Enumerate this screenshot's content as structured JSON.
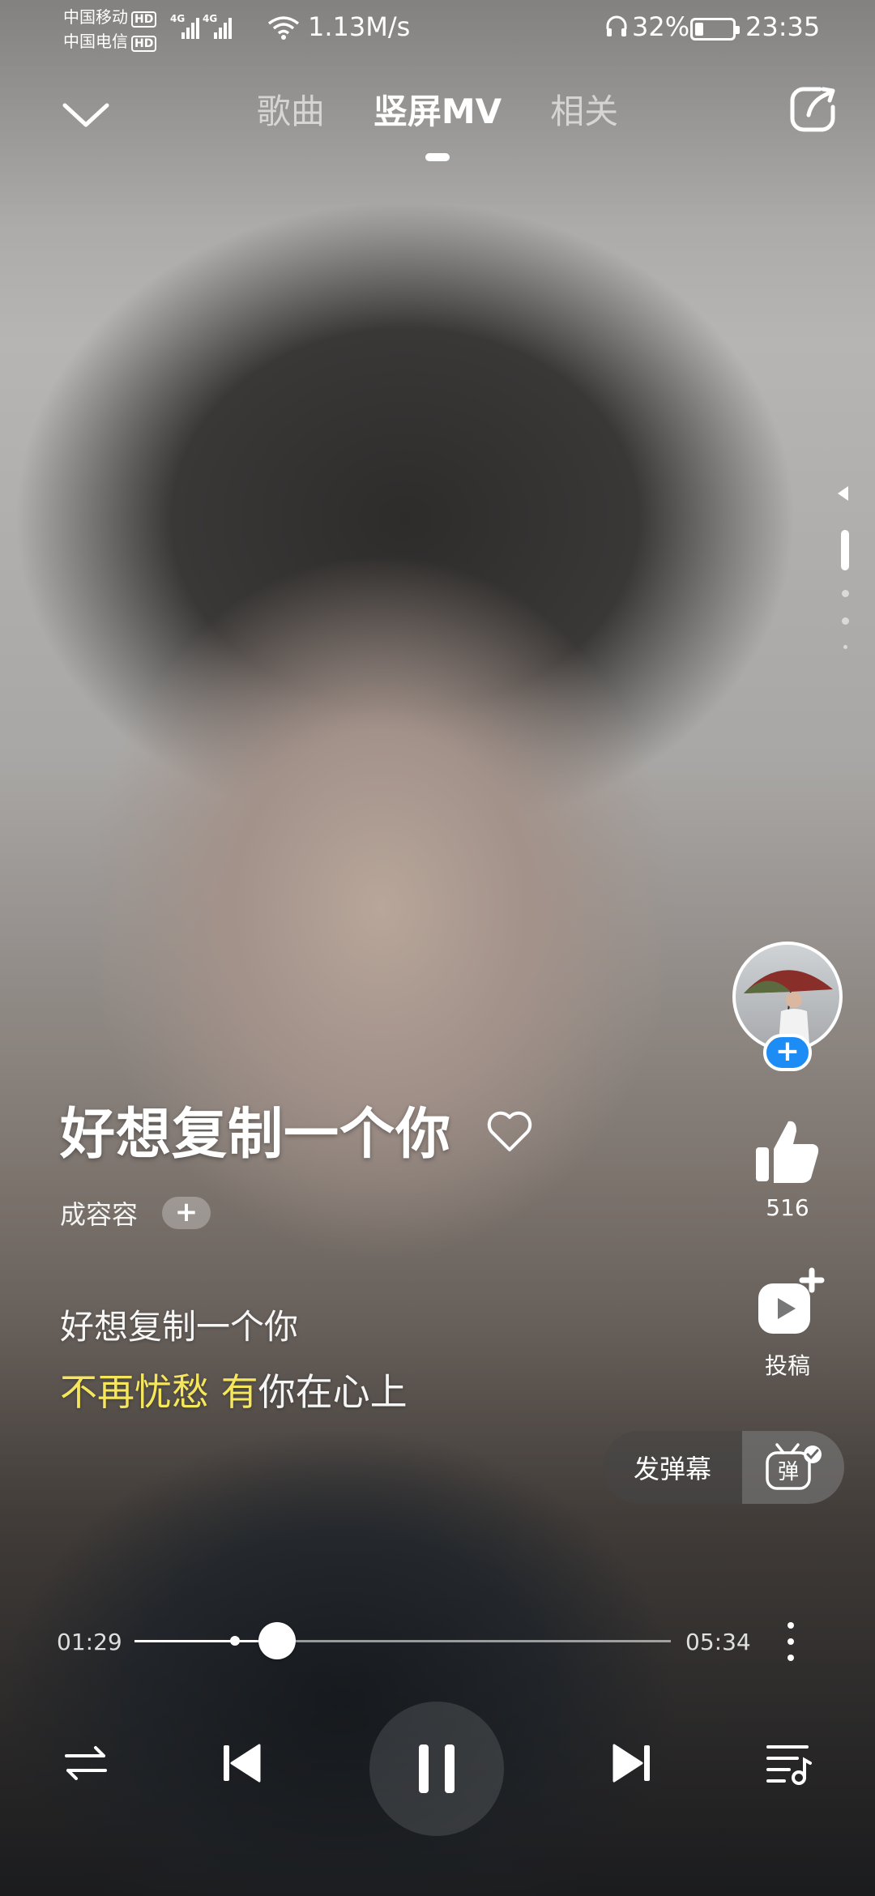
{
  "status_bar": {
    "carrier1": "中国移动",
    "carrier2": "中国电信",
    "hd_badge": "HD",
    "network": "4G",
    "net_speed": "1.13M/s",
    "battery_text": "32%",
    "battery_level": 0.32,
    "time": "23:35"
  },
  "nav": {
    "tabs": [
      {
        "label": "歌曲"
      },
      {
        "label": "竖屏MV"
      },
      {
        "label": "相关"
      }
    ],
    "active_tab": "竖屏MV",
    "back_icon": "chevron-down-icon",
    "share_icon": "share-icon"
  },
  "song": {
    "title": "好想复制一个你",
    "artist": "成容容",
    "artist_follow_label": "+",
    "favorite_icon": "heart-outline-icon"
  },
  "lyrics": {
    "line1": "好想复制一个你",
    "line2_highlight": "不再忧愁 有",
    "line2_rest": "你在心上",
    "highlight_color": "#f5e65c"
  },
  "actions": {
    "avatar_follow_label": "+",
    "like_count": "516",
    "submit_label": "投稿",
    "follow_color": "#1e8cf5"
  },
  "danmaku": {
    "label": "发弹幕",
    "toggle_glyph": "弹"
  },
  "playback": {
    "current_time": "01:29",
    "total_time": "05:34",
    "progress": 0.266,
    "buffered": 0.187
  },
  "controls": {
    "mode_icon": "shuffle-mode-icon",
    "prev_icon": "previous-icon",
    "play_icon": "pause-icon",
    "next_icon": "next-icon",
    "list_icon": "playlist-icon"
  }
}
